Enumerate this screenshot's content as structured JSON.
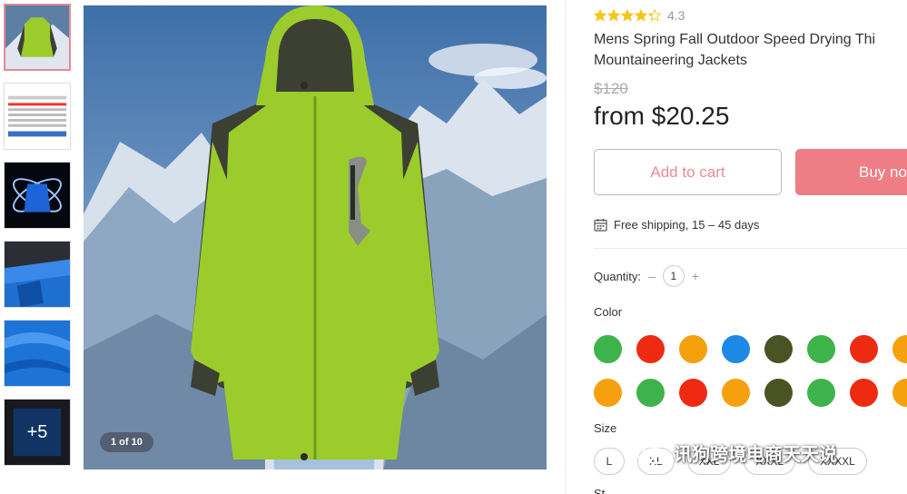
{
  "thumbnails": [
    {
      "name": "thumb-jacket-front",
      "active": true
    },
    {
      "name": "thumb-size-chart",
      "active": false
    },
    {
      "name": "thumb-blue-glow",
      "active": false
    },
    {
      "name": "thumb-blue-detail",
      "active": false
    },
    {
      "name": "thumb-blue-fabric",
      "active": false
    },
    {
      "name": "thumb-more",
      "active": false,
      "more_label": "+5"
    }
  ],
  "gallery": {
    "counter": "1 of 10"
  },
  "product": {
    "rating_value": "4.3",
    "rating_stars": 4.3,
    "title_line1": "Mens Spring Fall Outdoor Speed Drying Thi",
    "title_line2": "Mountaineering Jackets",
    "old_price": "$120",
    "price": "from $20.25"
  },
  "actions": {
    "add_to_cart": "Add to cart",
    "buy_now": "Buy no"
  },
  "shipping": {
    "text": "Free shipping, 15 – 45 days",
    "icon": "calendar-icon"
  },
  "quantity": {
    "label": "Quantity:",
    "minus": "–",
    "value": "1",
    "plus": "+"
  },
  "color": {
    "label": "Color",
    "row1": [
      "#3db44a",
      "#ee2b10",
      "#f5a10e",
      "#1e88e5",
      "#4a5324",
      "#3db44a",
      "#ee2b10",
      "#f5a10e"
    ],
    "row2": [
      "#f5a10e",
      "#3db44a",
      "#ee2b10",
      "#f5a10e",
      "#4a5324",
      "#3db44a",
      "#ee2b10",
      "#f5a10e"
    ]
  },
  "size": {
    "label": "Size",
    "options": [
      "L",
      "XL",
      "XXL",
      "XXXL",
      "XXXXL"
    ]
  },
  "next_section": "St",
  "watermark": {
    "text": "讯狗跨境电商天天说"
  },
  "colors": {
    "accent": "#e98a97",
    "buy_bg": "#ef7d86",
    "star": "#f5c518"
  }
}
